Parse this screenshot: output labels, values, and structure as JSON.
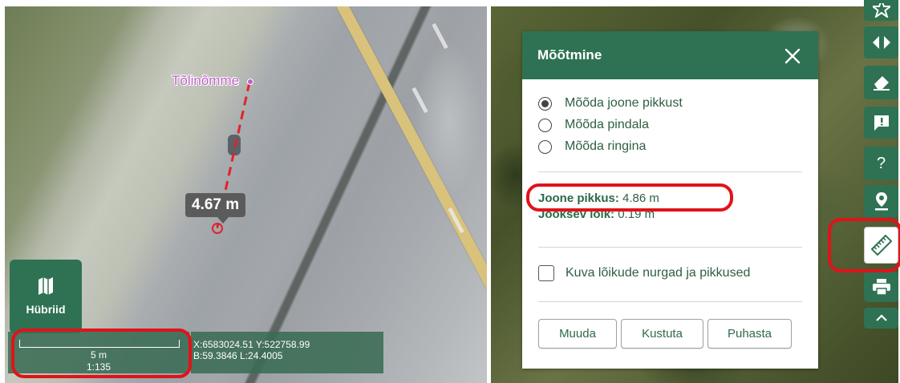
{
  "left_panel": {
    "place_label": "Tõlinõmme",
    "distance_tooltip": "4.67 m",
    "basemap_button_label": "Hübriid",
    "basemap_icon": "map-icon",
    "scale": {
      "length": "5 m",
      "ratio": "1:135"
    },
    "coordinates": {
      "line1": "X:6583024.51 Y:522758.99",
      "line2": "B:59.3846 L:24.4005"
    },
    "highlight_color": "#e0131a"
  },
  "dialog": {
    "title": "Mõõtmine",
    "options": [
      {
        "label": "Mõõda joone pikkust",
        "selected": true
      },
      {
        "label": "Mõõda pindala",
        "selected": false
      },
      {
        "label": "Mõõda ringina",
        "selected": false
      }
    ],
    "line_length_label": "Joone pikkus:",
    "line_length_value": " 4.86 m",
    "segment_label": "Jooksev lõik:",
    "segment_value": " 0.19 m",
    "checkbox_label": "Kuva lõikude nurgad ja pikkused",
    "checkbox_checked": false,
    "buttons": {
      "edit": "Muuda",
      "delete": "Kustuta",
      "clear": "Puhasta"
    },
    "accent_color": "#2e7253"
  },
  "toolbar": {
    "help_label": "?",
    "icons": [
      "star-icon",
      "swap-icon",
      "eraser-icon",
      "feedback-icon",
      "help-icon",
      "location-pin-icon",
      "ruler-icon",
      "print-icon",
      "chevron-up-icon"
    ]
  }
}
